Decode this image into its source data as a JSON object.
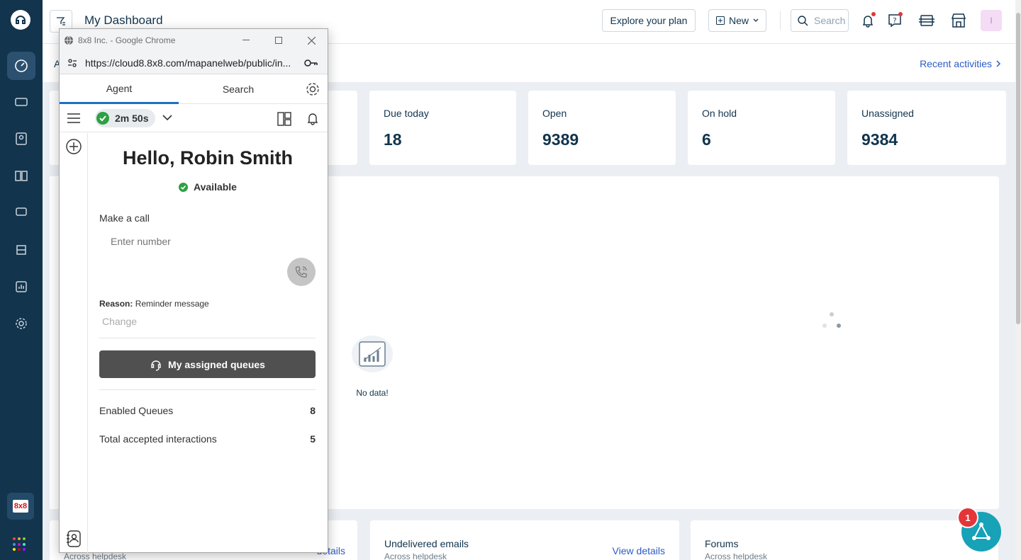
{
  "header": {
    "title": "My Dashboard",
    "explore_label": "Explore your plan",
    "new_label": "New",
    "search_placeholder": "Search",
    "avatar_initial": "I"
  },
  "subheader": {
    "truncated_label": "A",
    "recent_activities": "Recent activities"
  },
  "stats": [
    {
      "label": "Due today",
      "value": "18"
    },
    {
      "label": "Open",
      "value": "9389"
    },
    {
      "label": "On hold",
      "value": "6"
    },
    {
      "label": "Unassigned",
      "value": "9384"
    }
  ],
  "chart_panel": {
    "nodata": "No data!"
  },
  "bottom_cards": [
    {
      "title": "Undelivered emails",
      "subtitle": "Across helpdesk",
      "link": "View details"
    },
    {
      "title": "Forums",
      "subtitle": "Across helpdesk",
      "link": ""
    }
  ],
  "bottom_left": {
    "link_fragment": "details",
    "subtitle_fragment": "Across helpdesk"
  },
  "fab": {
    "badge": "1"
  },
  "nav": {
    "brand_label": "8x8"
  },
  "popup": {
    "window_title": "8x8 Inc. - Google Chrome",
    "url": "https://cloud8.8x8.com/mapanelweb/public/in...",
    "tabs": [
      "Agent",
      "Search"
    ],
    "timer": "2m 50s",
    "greeting": "Hello, Robin Smith",
    "status": "Available",
    "make_call_label": "Make a call",
    "number_placeholder": "Enter number",
    "reason_label": "Reason:",
    "reason_value": "Reminder message",
    "change_label": "Change",
    "queues_button": "My assigned queues",
    "rows": [
      {
        "label": "Enabled Queues",
        "value": "8"
      },
      {
        "label": "Total accepted interactions",
        "value": "5"
      }
    ]
  },
  "colors": {
    "nav_bg": "#12344d",
    "accent_blue": "#2c5cc5",
    "available_green": "#2ea043",
    "fab_teal": "#17a2b8",
    "badge_red": "#e43538"
  }
}
